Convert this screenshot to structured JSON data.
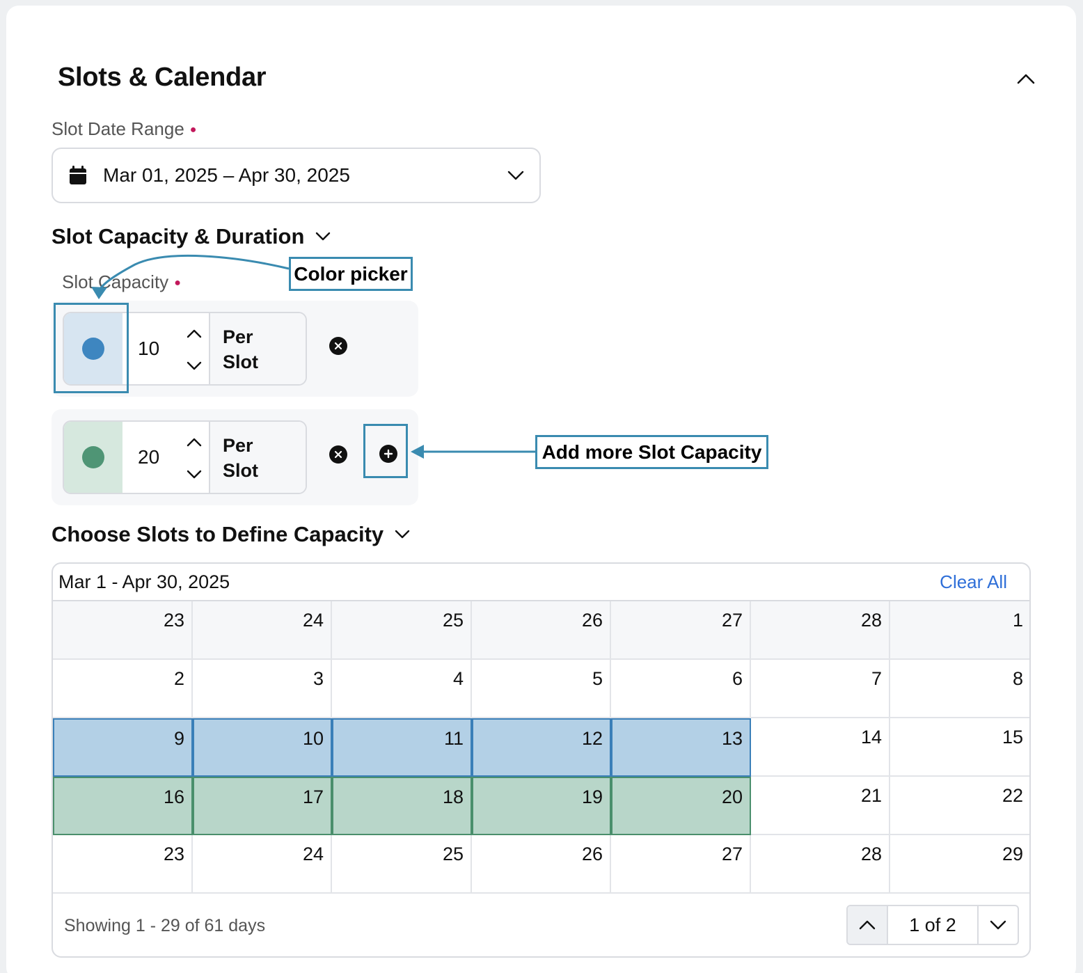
{
  "panel": {
    "title": "Slots & Calendar"
  },
  "date_range": {
    "label": "Slot Date Range",
    "value": "Mar 01, 2025 – Apr 30, 2025"
  },
  "capacity_section": {
    "title": "Slot Capacity & Duration",
    "field_label": "Slot Capacity"
  },
  "capacity_rows": [
    {
      "color": "#3e86c0",
      "swatch_bg": "#d7e5f1",
      "value": "10",
      "unit_line1": "Per",
      "unit_line2": "Slot"
    },
    {
      "color": "#4f9575",
      "swatch_bg": "#d6e8de",
      "value": "20",
      "unit_line1": "Per",
      "unit_line2": "Slot"
    }
  ],
  "annotations": {
    "color_picker": "Color picker",
    "add_more": "Add more Slot Capacity"
  },
  "slots_section": {
    "title": "Choose Slots to Define Capacity"
  },
  "calendar": {
    "range": "Mar 1 - Apr 30, 2025",
    "clear_all": "Clear All",
    "weeks": [
      [
        "23",
        "24",
        "25",
        "26",
        "27",
        "28",
        "1"
      ],
      [
        "2",
        "3",
        "4",
        "5",
        "6",
        "7",
        "8"
      ],
      [
        "9",
        "10",
        "11",
        "12",
        "13",
        "14",
        "15"
      ],
      [
        "16",
        "17",
        "18",
        "19",
        "20",
        "21",
        "22"
      ],
      [
        "23",
        "24",
        "25",
        "26",
        "27",
        "28",
        "29"
      ]
    ],
    "selection_colors": {
      "blue": "#b3d0e6",
      "green": "#b8d6c9"
    },
    "showing": "Showing 1 - 29 of 61 days",
    "page": "1 of 2"
  }
}
